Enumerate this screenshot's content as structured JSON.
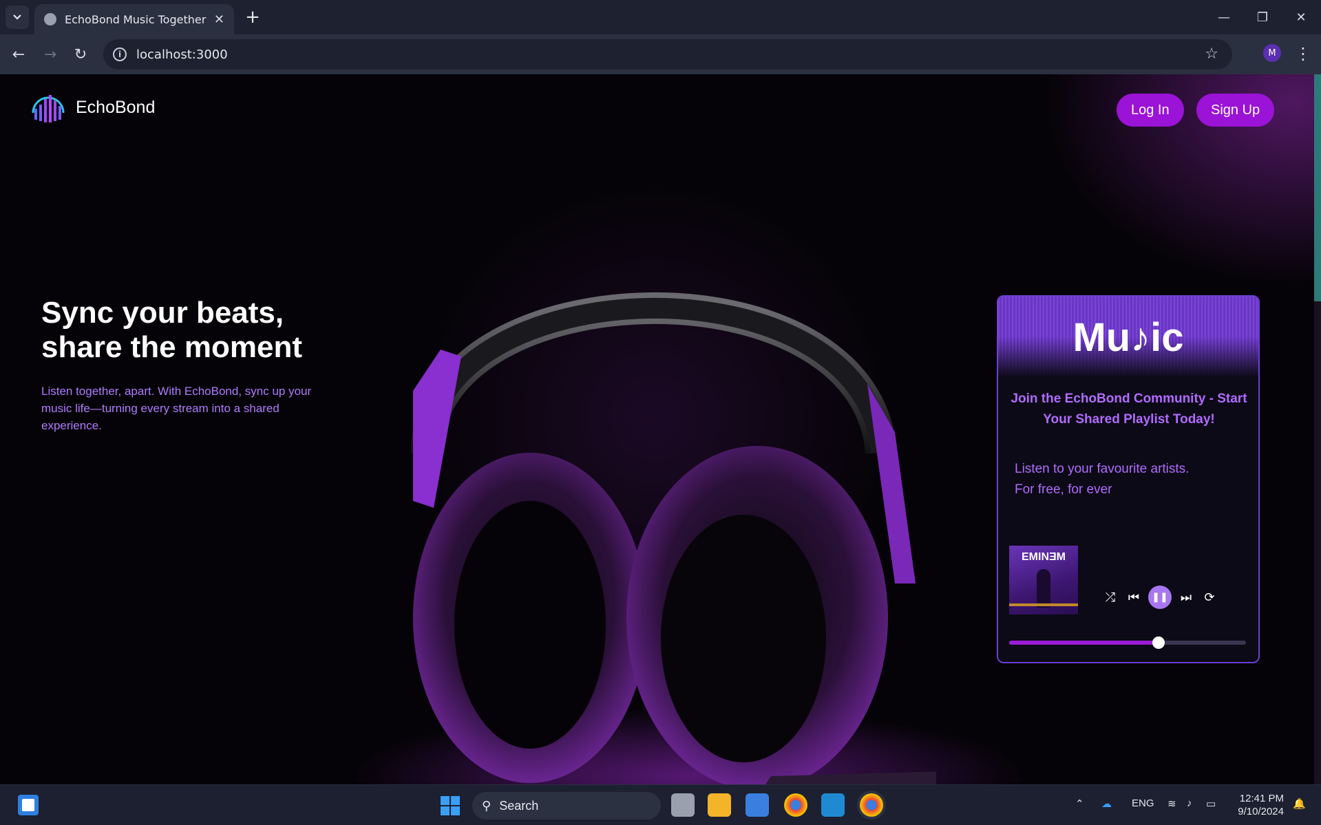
{
  "browser": {
    "tab_title": "EchoBond Music Together",
    "new_tab_symbol": "+",
    "url": "localhost:3000",
    "profile_initial": "M"
  },
  "header": {
    "brand_name": "EchoBond",
    "login_label": "Log In",
    "signup_label": "Sign Up"
  },
  "hero": {
    "title_line1": "Sync your beats,",
    "title_line2": "share the moment",
    "description": "Listen together, apart. With EchoBond, sync up your music life—turning every stream into a shared experience."
  },
  "card": {
    "logo_text": "Mu♪ic",
    "title": "Join the EchoBond Community - Start Your Shared Playlist Today!",
    "text_line1": "Listen to your favourite artists.",
    "text_line2": "For free, for ever",
    "album_art_text": "EMINƎM",
    "progress": 0.63,
    "controls": [
      "shuffle-icon",
      "previous-icon",
      "pause-icon",
      "next-icon",
      "repeat-icon"
    ]
  },
  "taskbar": {
    "search_label": "Search",
    "language": "ENG",
    "time": "12:41 PM",
    "date": "9/10/2024"
  },
  "colors": {
    "accent": "#9b13d6",
    "card_border": "#6d3fd3",
    "accent_text": "#b26bff"
  }
}
